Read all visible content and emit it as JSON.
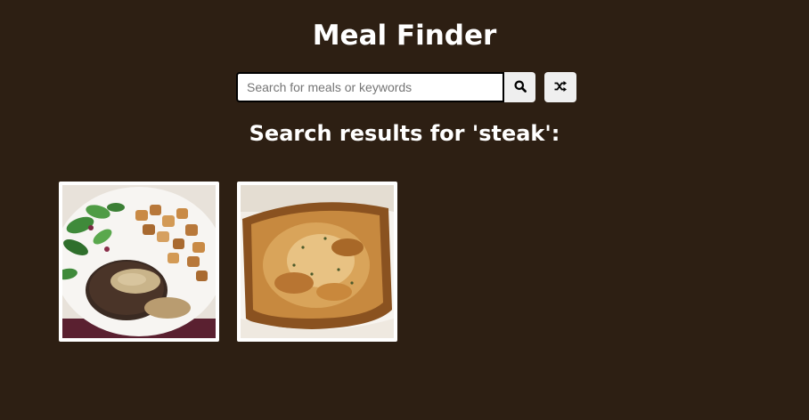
{
  "header": {
    "title": "Meal Finder"
  },
  "search": {
    "placeholder": "Search for meals or keywords",
    "value": "",
    "search_icon": "search-icon",
    "random_icon": "shuffle-icon"
  },
  "results": {
    "heading": "Search results for 'steak':",
    "meals": [
      {
        "image": "steak with peppercorn sauce, roasted potatoes and salad"
      },
      {
        "image": "steak pie with golden puff pastry"
      }
    ]
  }
}
